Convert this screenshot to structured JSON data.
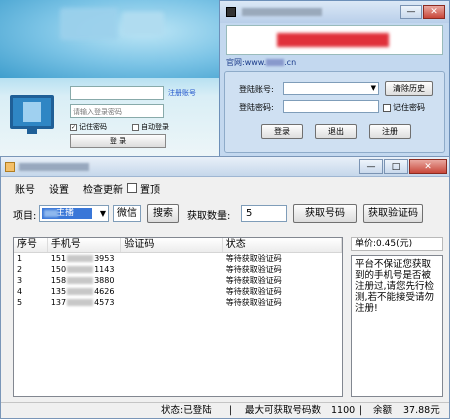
{
  "bg_login": {
    "account_link": "注册账号",
    "password_placeholder": "请输入登录密码",
    "remember_label": "记住密码",
    "auto_login_label": "自动登录",
    "login_button": "登 录"
  },
  "float_login": {
    "site_prefix": "官网:www.",
    "site_suffix": ".cn",
    "account_label": "登陆账号:",
    "password_label": "登陆密码:",
    "history_button": "清除历史",
    "remember_label": "记住密码",
    "login_button": "登录",
    "exit_button": "退出",
    "register_button": "注册",
    "window_buttons": [
      "—",
      "✕"
    ]
  },
  "main": {
    "window_buttons": [
      "—",
      "□",
      "✕"
    ],
    "menu": {
      "account": "账号",
      "settings": "设置",
      "check_update": "检查更新",
      "topmost": "置顶"
    },
    "toolbar": {
      "project_label": "项目:",
      "project_value": "主播",
      "keyword_value": "微信",
      "search_button": "搜索",
      "quantity_label": "获取数量:",
      "quantity_value": "5",
      "get_number_button": "获取号码",
      "get_code_button": "获取验证码"
    },
    "table": {
      "headers": [
        "序号",
        "手机号",
        "验证码",
        "状态"
      ],
      "rows": [
        {
          "index": "1",
          "phone_prefix": "151",
          "phone_suffix": "3953",
          "code": "",
          "status": "等待获取验证码"
        },
        {
          "index": "2",
          "phone_prefix": "150",
          "phone_suffix": "1143",
          "code": "",
          "status": "等待获取验证码"
        },
        {
          "index": "3",
          "phone_prefix": "158",
          "phone_suffix": "3880",
          "code": "",
          "status": "等待获取验证码"
        },
        {
          "index": "4",
          "phone_prefix": "135",
          "phone_suffix": "4626",
          "code": "",
          "status": "等待获取验证码"
        },
        {
          "index": "5",
          "phone_prefix": "137",
          "phone_suffix": "4573",
          "code": "",
          "status": "等待获取验证码"
        }
      ]
    },
    "price": "单价:0.45(元)",
    "notice": "平台不保证您获取到的手机号是否被注册过,请您先行检测,若不能接受请勿注册!",
    "status": {
      "state": "状态:已登陆",
      "sep1": "|",
      "max_label": "最大可获取号码数",
      "max_value": "1100",
      "sep2": "|",
      "balance_label": "余额",
      "balance_value": "37.88元"
    }
  }
}
